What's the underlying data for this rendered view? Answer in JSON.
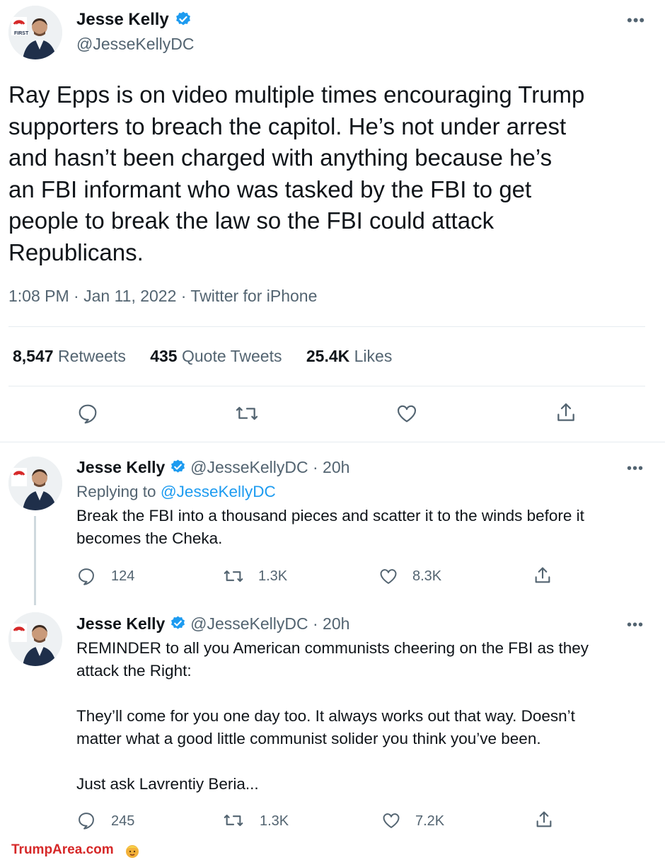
{
  "main_tweet": {
    "display_name": "Jesse Kelly",
    "handle": "@JesseKellyDC",
    "avatar_badge": "FIRST",
    "text_lines": [
      "Ray Epps is on video multiple times encouraging Trump",
      "supporters to breach the capitol. He’s not under arrest",
      "and hasn’t been charged with anything because he’s",
      "an FBI informant who was tasked by the FBI to get",
      "people to break the law so the FBI could attack",
      "Republicans."
    ],
    "meta": "1:08 PM · Jan 11, 2022 · Twitter for iPhone",
    "stats": {
      "retweets_count": "8,547",
      "retweets_label": "Retweets",
      "quotes_count": "435",
      "quotes_label": "Quote Tweets",
      "likes_count": "25.4K",
      "likes_label": "Likes"
    },
    "more_icon": "more-horizontal-icon"
  },
  "replies": [
    {
      "display_name": "Jesse Kelly",
      "handle_time": "@JesseKellyDC · 20h",
      "replying_prefix": "Replying to",
      "replying_to": "@JesseKellyDC",
      "text_lines": [
        "Break the FBI into a thousand pieces and scatter it to the winds before it",
        "becomes the Cheka."
      ],
      "replies": "124",
      "retweets": "1.3K",
      "likes": "8.3K"
    },
    {
      "display_name": "Jesse Kelly",
      "handle_time": "@JesseKellyDC · 20h",
      "text_lines": [
        "REMINDER to all you American communists cheering on the FBI as they",
        "attack the Right:",
        "",
        "They’ll come for you one day too. It always works out that way. Doesn’t",
        "matter what a good little communist solider you think you’ve been.",
        "",
        "Just ask Lavrentiy Beria..."
      ],
      "replies": "245",
      "retweets": "1.3K",
      "likes": "7.2K"
    }
  ],
  "footer": {
    "brand": "TrumpArea",
    "brand_suffix": ".com"
  },
  "colors": {
    "verified": "#1d9bf0",
    "secondary_text": "#536471",
    "link": "#1d9bf0",
    "divider": "#e6ecf0",
    "brand_red": "#d62828"
  }
}
